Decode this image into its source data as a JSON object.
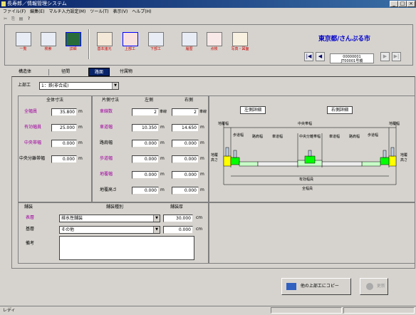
{
  "window": {
    "title": "長寿郎／情報管理システム"
  },
  "menu": [
    "ファイル(F)",
    "編集(E)",
    "マルチ入力設定(M)",
    "ツール(T)",
    "表示(V)",
    "ヘルプ(H)"
  ],
  "toolbar": {
    "tools": [
      {
        "label": "一覧",
        "icon": "list-icon"
      },
      {
        "label": "検索",
        "icon": "search-icon"
      },
      {
        "label": "詳細",
        "icon": "detail-icon"
      },
      {
        "label": "基本諸元",
        "icon": "basic-spec-icon"
      },
      {
        "label": "上部工",
        "icon": "superstructure-icon"
      },
      {
        "label": "下部工",
        "icon": "substructure-icon"
      },
      {
        "label": "履歴",
        "icon": "history-icon"
      },
      {
        "label": "点検",
        "icon": "inspection-icon"
      },
      {
        "label": "写真・図面",
        "icon": "photo-drawing-icon"
      }
    ],
    "location": "東京都/さんぷる市",
    "record_line1": "00000001",
    "record_line2": "JT00001号橋"
  },
  "tabs": [
    "構造体",
    "径間",
    "路面",
    "付属物"
  ],
  "selected_tab": "路面",
  "form": {
    "superstructure_label": "上部工",
    "superstructure_value": "1：鉄(非合成)",
    "section_total": "全体寸法",
    "section_oneside": "片側寸法",
    "col_left": "左側",
    "col_right": "右側",
    "total_width_label": "全幅員",
    "total_width_value": "35.800",
    "effective_width_label": "有効幅員",
    "effective_width_value": "25.000",
    "median_label": "中央帯幅",
    "median_value": "0.000",
    "median_sep_label": "中央分離帯幅",
    "median_sep_value": "0.000",
    "lanes_label": "車線数",
    "lanes_left": "2",
    "lanes_right": "2",
    "lane_unit": "車線",
    "road_width_label": "車道幅",
    "road_width_left": "10.350",
    "road_width_right": "14.650",
    "shoulder_label": "路肩幅",
    "shoulder_left": "0.000",
    "shoulder_right": "0.000",
    "sidewalk_label": "歩道幅",
    "sidewalk_left": "0.000",
    "sidewalk_right": "0.000",
    "curb_label": "地覆幅",
    "curb_left": "0.000",
    "curb_right": "0.000",
    "curb_height_label": "地覆高さ",
    "curb_height_left": "0.000",
    "curb_height_right": "0.000",
    "unit_m": "m",
    "unit_cm": "cm",
    "pavement_label": "舗装",
    "pavement_type_label": "舗装種別",
    "pavement_thick_label": "舗装厚",
    "surface_label": "表層",
    "surface_value": "排水性舗装",
    "surface_thick": "30.000",
    "base_label": "基層",
    "base_value": "その他",
    "base_thick": "0.000",
    "remarks_label": "備考"
  },
  "diagram": {
    "left_btn": "左側詳細",
    "right_btn": "右側詳細",
    "curb_w": "地覆幅",
    "sidewalk": "歩道幅",
    "shoulder": "路肩幅",
    "lane": "車道幅",
    "median_w": "中央帯幅",
    "median_sep": "中央分離帯幅",
    "curb_h": "地覆高さ",
    "effective": "有効幅員",
    "total": "全幅員"
  },
  "buttons": {
    "other_super": "他の上部工にコピー",
    "update": "更新"
  },
  "status": {
    "text": "レディ"
  }
}
